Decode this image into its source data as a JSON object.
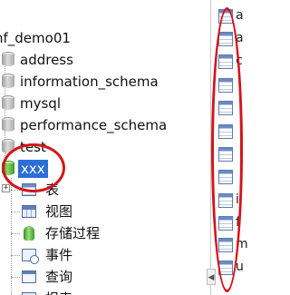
{
  "tree": {
    "connection": "nf_demo01",
    "databases": [
      "address",
      "information_schema",
      "mysql",
      "performance_schema",
      "test"
    ],
    "selected_db": "xxx",
    "children": [
      {
        "label": "表",
        "icon": "table-icon"
      },
      {
        "label": "视图",
        "icon": "view-icon"
      },
      {
        "label": "存储过程",
        "icon": "stored-procedure-icon"
      },
      {
        "label": "事件",
        "icon": "event-icon"
      },
      {
        "label": "查询",
        "icon": "query-icon"
      },
      {
        "label": "报表",
        "icon": "report-icon"
      }
    ]
  },
  "right_pane": {
    "item_letters": [
      "a",
      "a",
      "c",
      "",
      "",
      "",
      "",
      "",
      "i",
      "f",
      "m",
      "u"
    ]
  },
  "annotation_color": "#d3151b"
}
